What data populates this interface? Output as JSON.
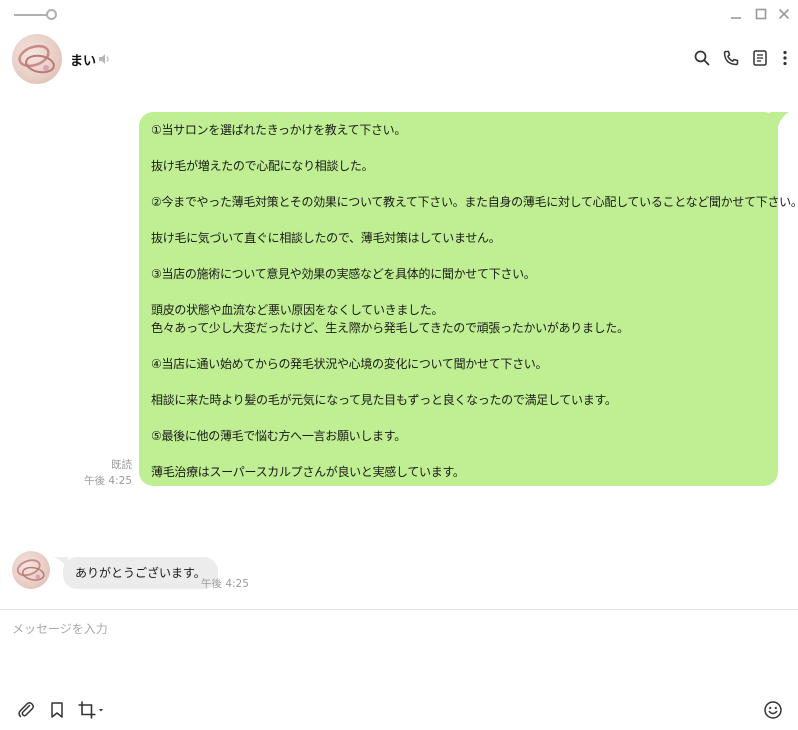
{
  "header": {
    "contact_name": "まい"
  },
  "icons": {
    "pin": "pin-toggle-icon",
    "minimize": "minimize-icon",
    "maximize": "maximize-icon",
    "close": "close-icon",
    "speaker": "speaker-icon",
    "search": "search-icon",
    "call": "phone-icon",
    "notes": "notes-icon",
    "more": "more-vertical-icon",
    "attach": "paperclip-icon",
    "bookmark": "bookmark-icon",
    "screenshot": "crop-icon",
    "emoji": "emoji-icon"
  },
  "colors": {
    "sent_bubble": "#c0ef93",
    "received_bubble": "#ececec",
    "meta_text": "#9a9a9a"
  },
  "messages": {
    "sent": {
      "lines": [
        "①当サロンを選ばれたきっかけを教えて下さい。",
        "",
        "抜け毛が増えたので心配になり相談した。",
        "",
        "②今までやった薄毛対策とその効果について教えて下さい。また自身の薄毛に対して心配していることなど聞かせて下さい。",
        "",
        "抜け毛に気づいて直ぐに相談したので、薄毛対策はしていません。",
        "",
        "③当店の施術について意見や効果の実感などを具体的に聞かせて下さい。",
        "",
        "頭皮の状態や血流など悪い原因をなくしていきました。",
        "色々あって少し大変だったけど、生え際から発毛してきたので頑張ったかいがありました。",
        "",
        "④当店に通い始めてからの発毛状況や心境の変化について聞かせて下さい。",
        "",
        "相談に来た時より髪の毛が元気になって見た目もずっと良くなったので満足しています。",
        "",
        "⑤最後に他の薄毛で悩む方へ一言お願いします。",
        "",
        "薄毛治療はスーパースカルプさんが良いと実感しています。"
      ],
      "read_status": "既読",
      "time": "午後 4:25"
    },
    "received": {
      "text": "ありがとうございます。",
      "time": "午後 4:25"
    }
  },
  "input": {
    "placeholder": "メッセージを入力",
    "value": ""
  }
}
